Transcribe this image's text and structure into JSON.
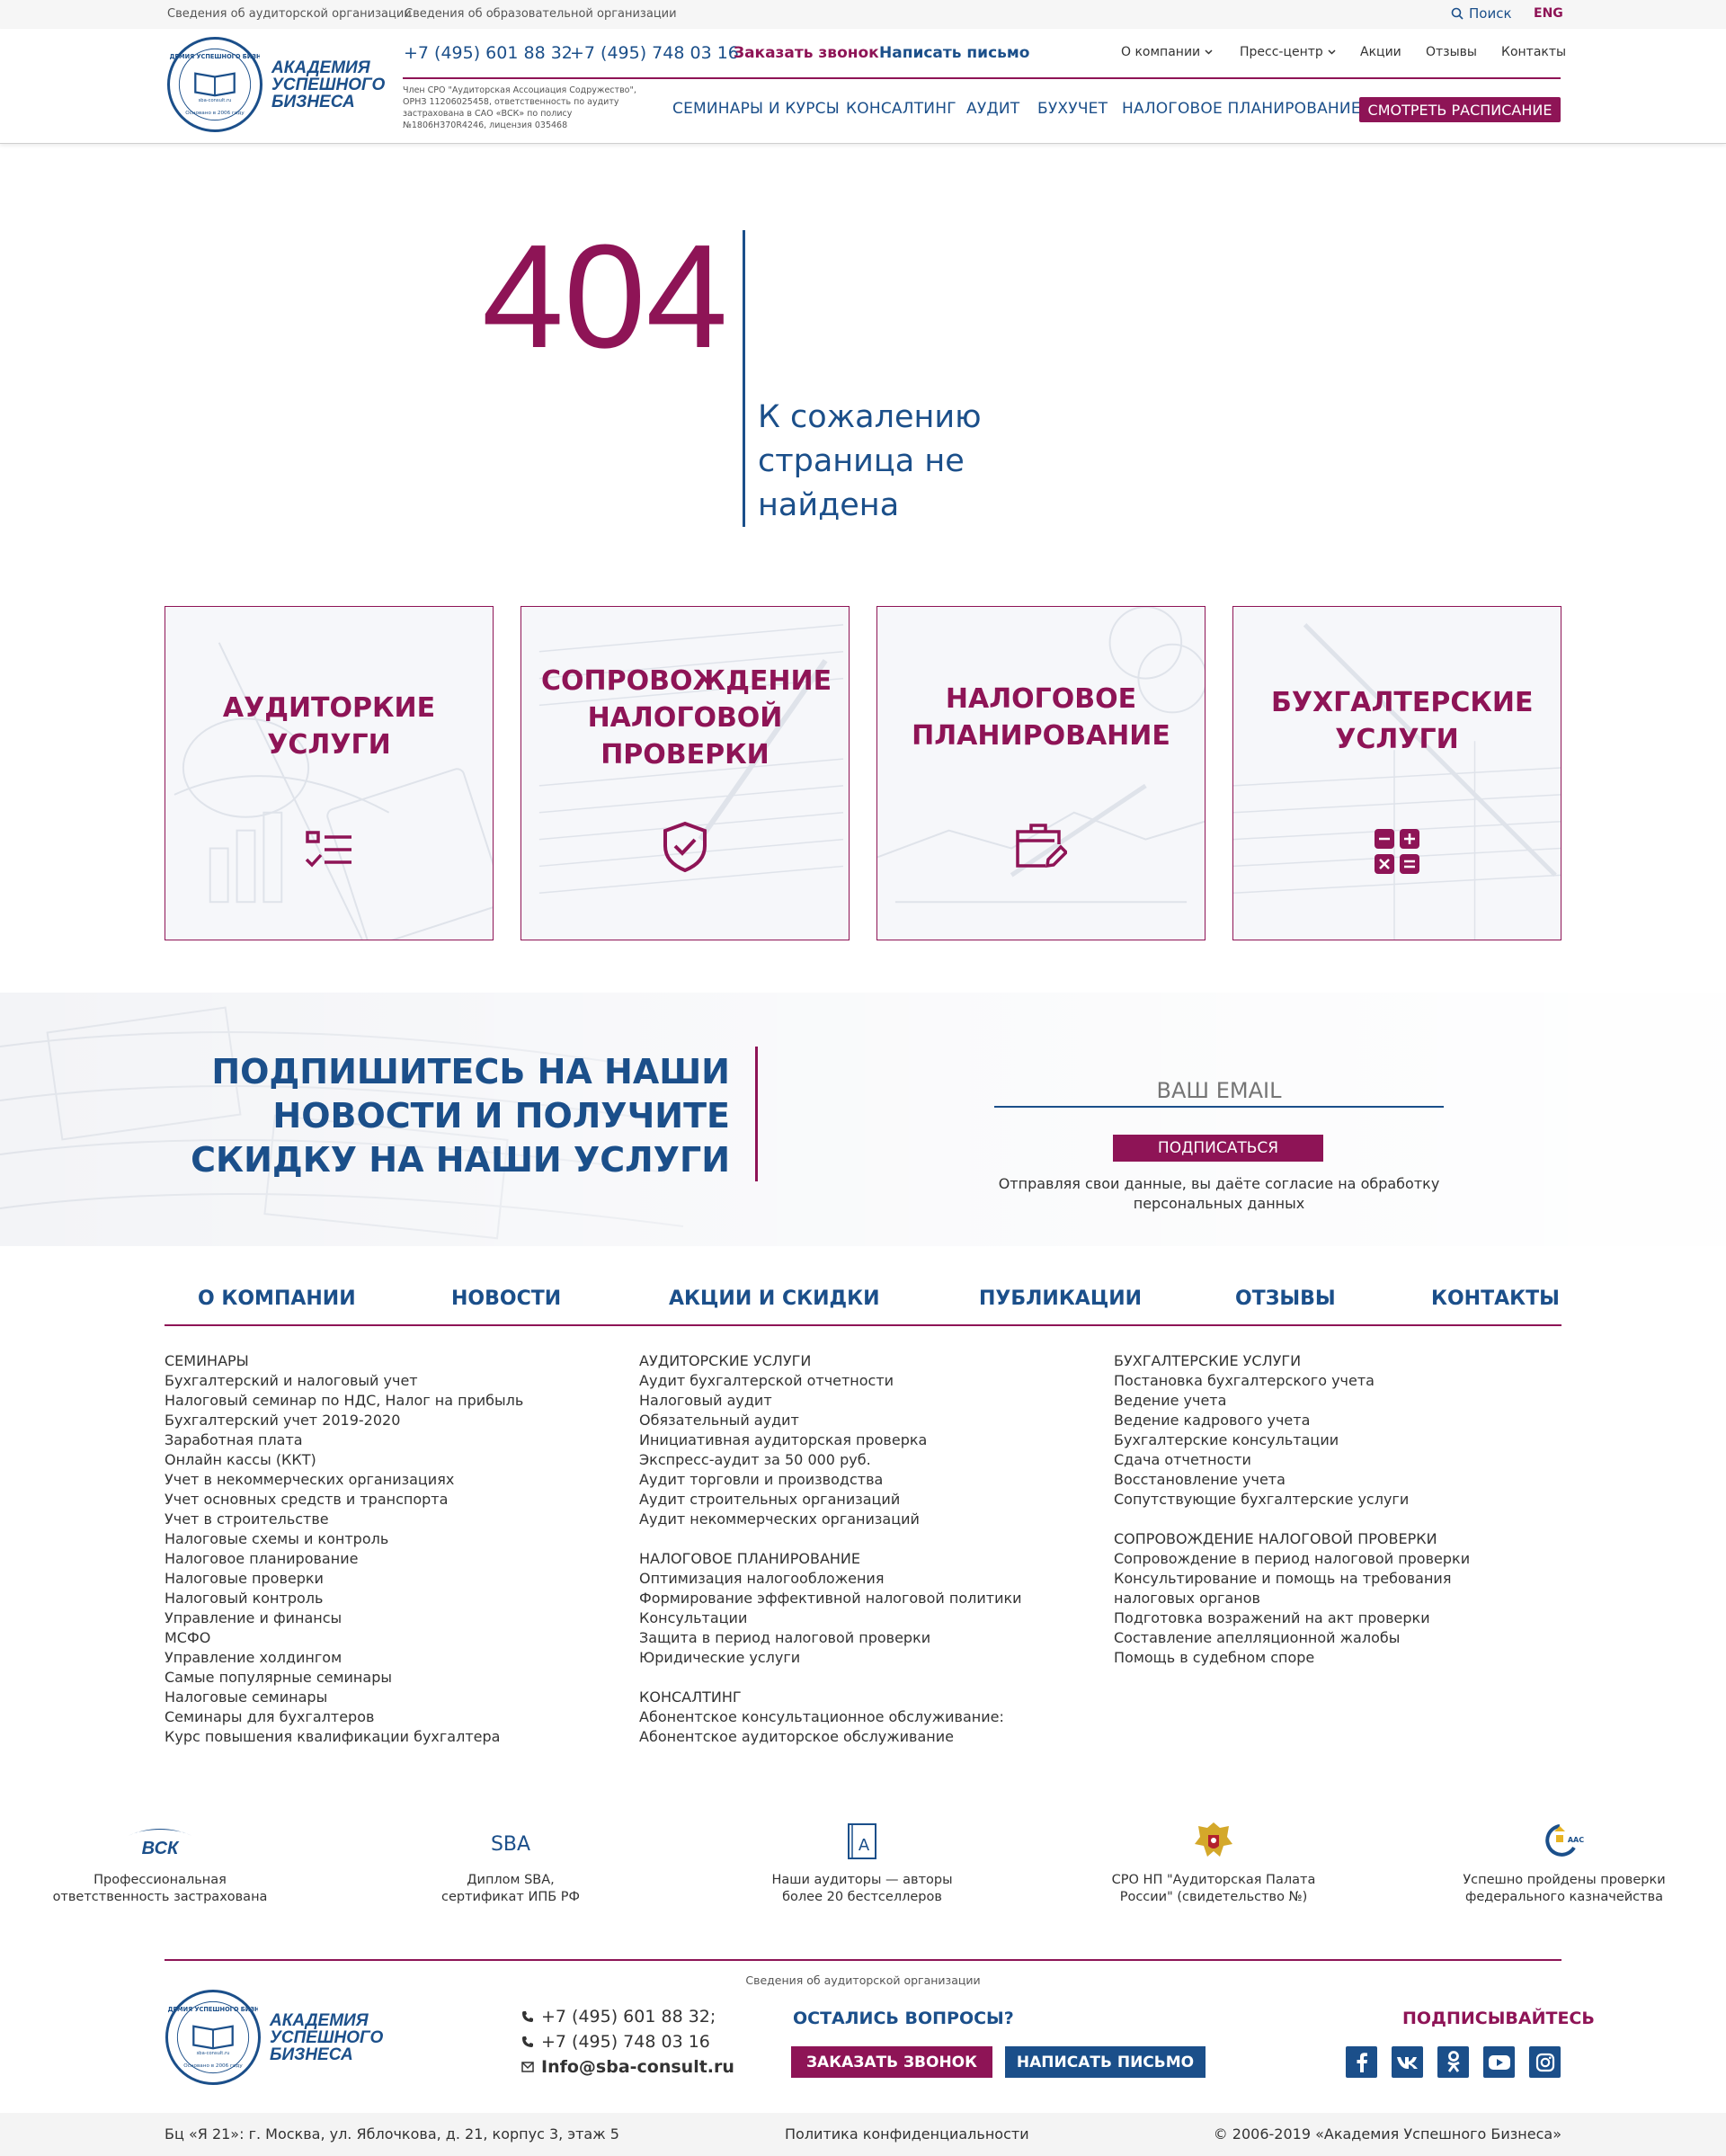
{
  "topbar": {
    "link1": "Сведения об аудиторской организации",
    "link2": "Сведения об образовательной организации",
    "search": "Поиск",
    "lang": "ENG"
  },
  "header": {
    "logo_line1": "Академия",
    "logo_line2": "Успешного",
    "logo_line3": "Бизнеса",
    "logo_ring_text": "Академия Успешного Бизнеса",
    "logo_ring_bottom": "Основано в 2006 году",
    "logo_site": "sba-consult.ru",
    "phone1": "+7 (495) 601 88 32",
    "phone2": "+7 (495) 748 03 16",
    "callback": "Заказать звонок",
    "write": "Написать письмо",
    "sro_text": "Член СРО \"Аудиторская Ассоциация Содружество\", ОРНЗ 11206025458, ответственность по аудиту застрахована в САО «ВСК» по полису №1806Н370R4246, лицензия 035468",
    "nav_small": [
      "О компании",
      "Пресс-центр",
      "Акции",
      "Отзывы",
      "Контакты"
    ],
    "nav_main": [
      "СЕМИНАРЫ И КУРСЫ",
      "КОНСАЛТИНГ",
      "АУДИТ",
      "БУХУЧЕТ",
      "НАЛОГОВОЕ ПЛАНИРОВАНИЕ"
    ],
    "schedule": "СМОТРЕТЬ РАСПИСАНИЕ"
  },
  "error": {
    "code": "404",
    "message": "К сожалению страница не найдена"
  },
  "cards": [
    {
      "title": "АУДИТОРКИЕ УСЛУГИ",
      "icon": "checklist-icon"
    },
    {
      "title": "СОПРОВОЖДЕНИЕ НАЛОГОВОЙ ПРОВЕРКИ",
      "icon": "shield-check-icon"
    },
    {
      "title": "НАЛОГОВОЕ ПЛАНИРОВАНИЕ",
      "icon": "briefcase-edit-icon"
    },
    {
      "title": "БУХГАЛТЕРСКИЕ УСЛУГИ",
      "icon": "calculator-icon"
    }
  ],
  "subscribe": {
    "title": "ПОДПИШИТЕСЬ НА НАШИ НОВОСТИ И ПОЛУЧИТЕ СКИДКУ НА НАШИ УСЛУГИ",
    "email_placeholder": "ВАШ EMAIL",
    "button": "ПОДПИСАТЬСЯ",
    "note": "Отправляя свои данные, вы даёте согласие на обработку персональных данных"
  },
  "footer_nav": [
    "О КОМПАНИИ",
    "НОВОСТИ",
    "АКЦИИ И СКИДКИ",
    "ПУБЛИКАЦИИ",
    "ОТЗЫВЫ",
    "КОНТАКТЫ"
  ],
  "footer_cols": {
    "col1": {
      "heading": "СЕМИНАРЫ",
      "items": [
        "Бухгалтерский и налоговый учет",
        "Налоговый семинар по НДС, Налог на прибыль",
        "Бухгалтерский учет 2019-2020",
        "Заработная плата",
        "Онлайн кассы (ККТ)",
        "Учет в некоммерческих организациях",
        "Учет основных средств и транспорта",
        "Учет в строительстве",
        "Налоговые схемы и контроль",
        "Налоговое планирование",
        "Налоговые проверки",
        "Налоговый контроль",
        "Управление и финансы",
        "МСФО",
        "Управление холдингом",
        "Самые популярные семинары",
        "Налоговые семинары",
        "Семинары для бухгалтеров",
        "Курс повышения квалификации бухгалтера"
      ]
    },
    "col2": {
      "heading1": "АУДИТОРСКИЕ УСЛУГИ",
      "items1": [
        "Аудит бухгалтерской отчетности",
        "Налоговый аудит",
        "Обязательный аудит",
        "Инициативная аудиторская проверка",
        "Экспресс-аудит за 50 000 руб.",
        "Аудит торговли и производства",
        "Аудит строительных организаций",
        "Аудит некоммерческих организаций"
      ],
      "heading2": "НАЛОГОВОЕ ПЛАНИРОВАНИЕ",
      "items2": [
        "Оптимизация налогообложения",
        "Формирование эффективной налоговой политики",
        "Консультации",
        "Защита в период налоговой проверки",
        "Юридические услуги"
      ],
      "heading3": "КОНСАЛТИНГ",
      "items3": [
        "Абонентское консультационное обслуживание:",
        "Абонентское аудиторское обслуживание"
      ]
    },
    "col3": {
      "heading1": "БУХГАЛТЕРСКИЕ УСЛУГИ",
      "items1": [
        "Постановка бухгалтерского учета",
        "Ведение учета",
        "Ведение кадрового учета",
        "Бухгалтерские консультации",
        "Сдача отчетности",
        "Восстановление учета",
        "Сопутствующие бухгалтерские услуги"
      ],
      "heading2": "СОПРОВОЖДЕНИЕ НАЛОГОВОЙ ПРОВЕРКИ",
      "items2": [
        "Сопровождение в период налоговой проверки",
        "Консультирование и помощь на требования налоговых органов",
        "Подготовка возражений на акт проверки",
        "Составление апелляционной жалобы",
        "Помощь в судебном споре"
      ]
    }
  },
  "badges": [
    {
      "logo": "ВСК",
      "line1": "Профессиональная",
      "line2": "ответственность застрахована"
    },
    {
      "logo": "SBA",
      "line1": "Диплом SBA,",
      "line2": "сертификат ИПБ РФ"
    },
    {
      "logo": "A",
      "line1": "Наши аудиторы — авторы",
      "line2": "более 20 бестселлеров"
    },
    {
      "logo": "emblem",
      "line1": "СРО НП \"Аудиторская Палата",
      "line2": "России\" (свидетельство №)"
    },
    {
      "logo": "ААС",
      "line1": "Успешно пройдены проверки",
      "line2": "федерального казначейства"
    }
  ],
  "footer": {
    "info_link": "Сведения об аудиторской организации",
    "phone1": "+7 (495) 601 88 32;",
    "phone2": "+7 (495) 748 03 16",
    "email": "Info@sba-consult.ru",
    "questions": "ОСТАЛИСЬ ВОПРОСЫ?",
    "callback_btn": "ЗАКАЗАТЬ ЗВОНОК",
    "write_btn": "НАПИСАТЬ ПИСЬМО",
    "subscribe_social": "ПОДПИСЫВАЙТЕСЬ",
    "social": [
      "f",
      "vk",
      "ok",
      "youtube",
      "instagram"
    ],
    "address": "Бц «Я 21»: г. Москва, ул. Яблочкова, д. 21, корпус 3, этаж 5",
    "privacy": "Политика конфиденциальности",
    "copyright": "© 2006-2019 «Академия Успешного Бизнеса»"
  },
  "colors": {
    "brand_blue": "#1b4f8a",
    "brand_magenta": "#8e1456"
  }
}
